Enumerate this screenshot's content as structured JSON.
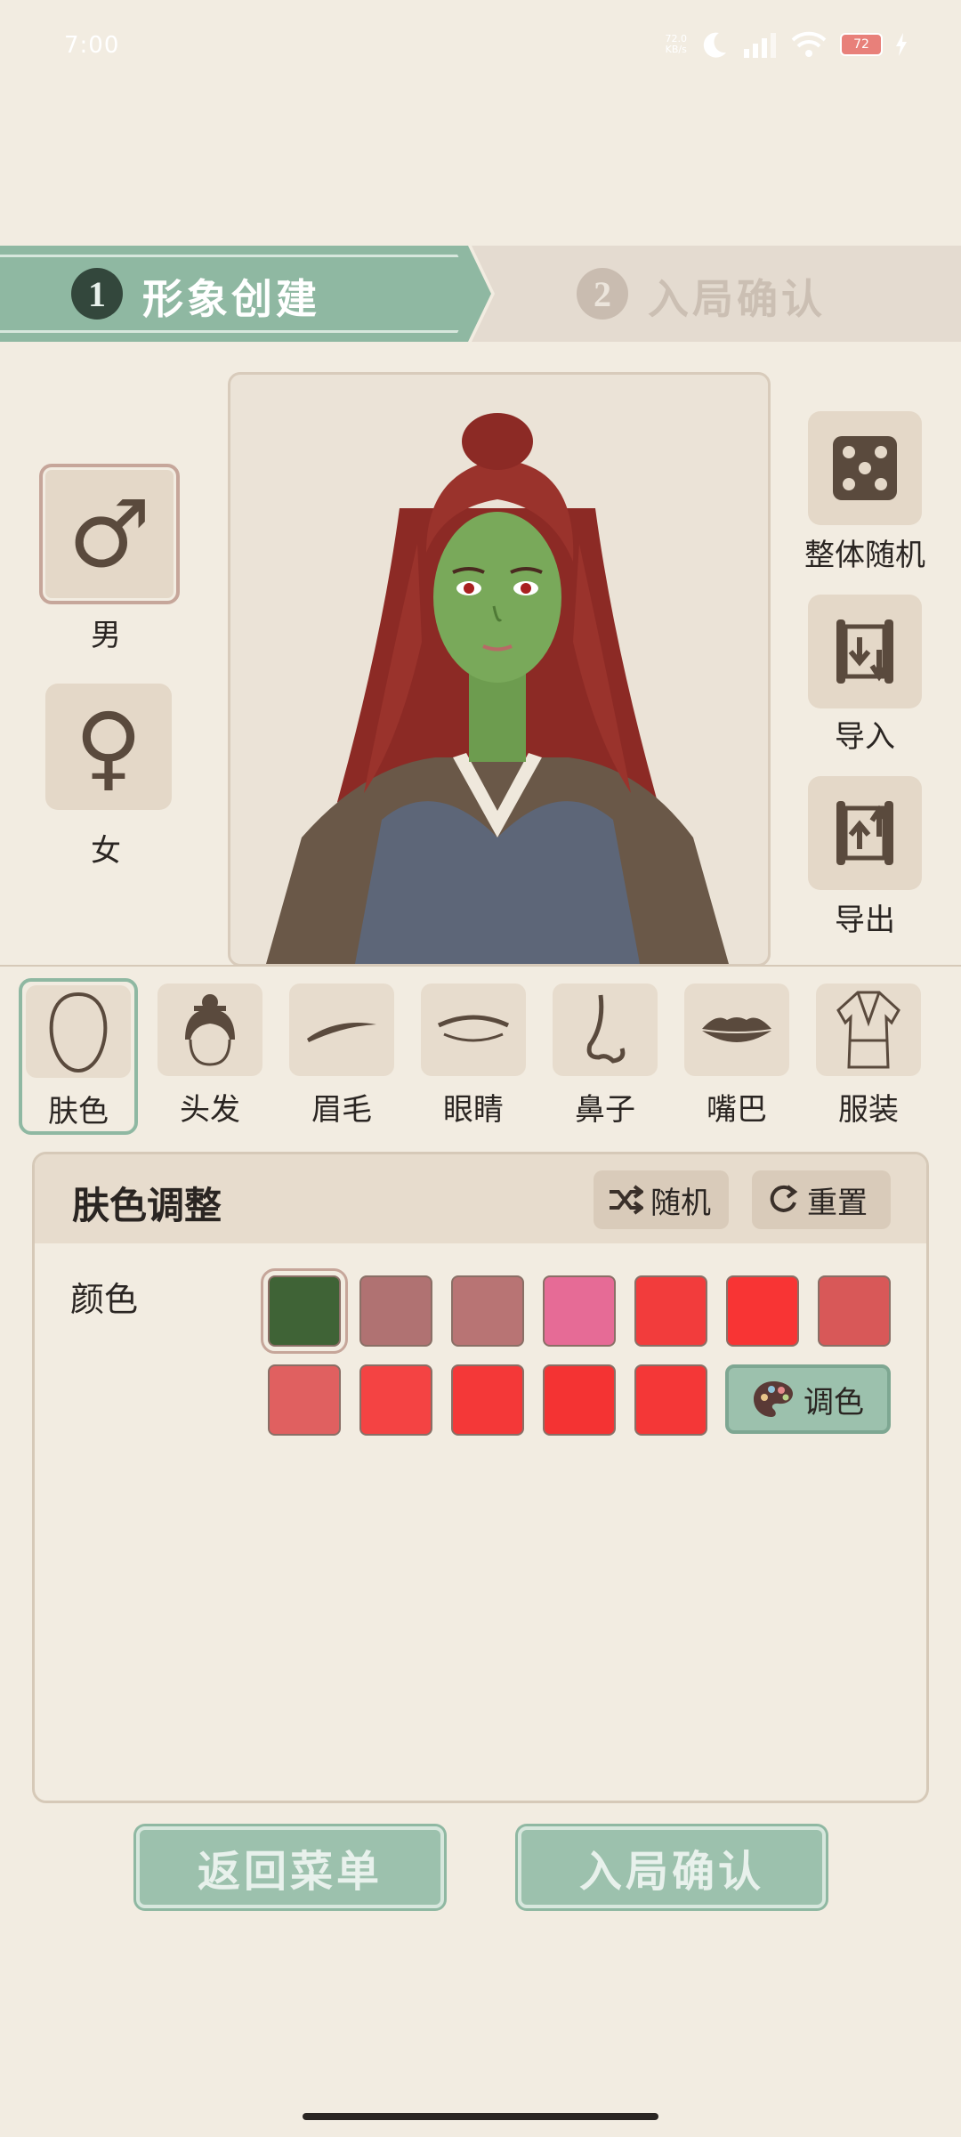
{
  "status_bar": {
    "time": "7:00",
    "net_speed_top": "72.0",
    "net_speed_bottom": "KB/s",
    "signal_label": "5G",
    "battery": "72"
  },
  "steps": [
    {
      "number": "1",
      "label": "形象创建",
      "active": true
    },
    {
      "number": "2",
      "label": "入局确认",
      "active": false
    }
  ],
  "gender": {
    "male": {
      "symbol": "♂",
      "label": "男",
      "selected": true
    },
    "female": {
      "symbol": "♀",
      "label": "女",
      "selected": false
    }
  },
  "tools": {
    "random_all": "整体随机",
    "import": "导入",
    "export": "导出"
  },
  "features": [
    {
      "id": "skin",
      "label": "肤色",
      "active": true
    },
    {
      "id": "hair",
      "label": "头发",
      "active": false
    },
    {
      "id": "brow",
      "label": "眉毛",
      "active": false
    },
    {
      "id": "eyes",
      "label": "眼睛",
      "active": false
    },
    {
      "id": "nose",
      "label": "鼻子",
      "active": false
    },
    {
      "id": "mouth",
      "label": "嘴巴",
      "active": false
    },
    {
      "id": "clothes",
      "label": "服装",
      "active": false
    }
  ],
  "panel": {
    "title": "肤色调整",
    "random_label": "随机",
    "reset_label": "重置",
    "color_label": "颜色",
    "tune_label": "调色",
    "swatches_row1": [
      "#3f6336",
      "#b07272",
      "#b87474",
      "#e66b96",
      "#f23c3c",
      "#f83434",
      "#d85858"
    ],
    "swatches_row2": [
      "#e06060",
      "#f44343",
      "#f43838",
      "#f43333",
      "#f43737"
    ],
    "selected_swatch": 0
  },
  "bottom": {
    "back_label": "返回菜单",
    "confirm_label": "入局确认"
  },
  "colors": {
    "accent_green": "#8fb8a2",
    "background": "#f2ece1",
    "tile": "#e4d8c8"
  }
}
